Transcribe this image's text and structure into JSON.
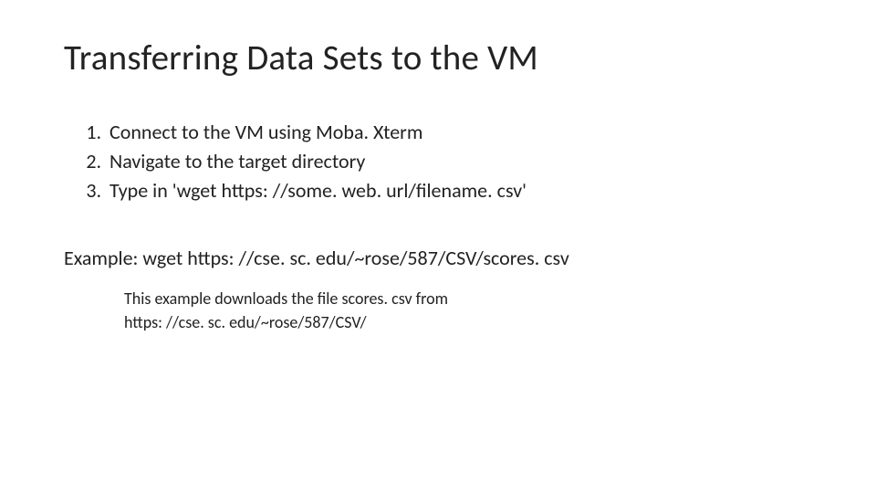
{
  "title": "Transferring Data Sets to the VM",
  "steps": [
    "Connect to the VM using Moba. Xterm",
    "Navigate to the target directory",
    "Type in 'wget https: //some. web. url/filename. csv'"
  ],
  "example_line": "Example:  wget https: //cse. sc. edu/~rose/587/CSV/scores. csv",
  "note_line1": "This example downloads the file scores. csv from",
  "note_line2": "https: //cse. sc. edu/~rose/587/CSV/"
}
